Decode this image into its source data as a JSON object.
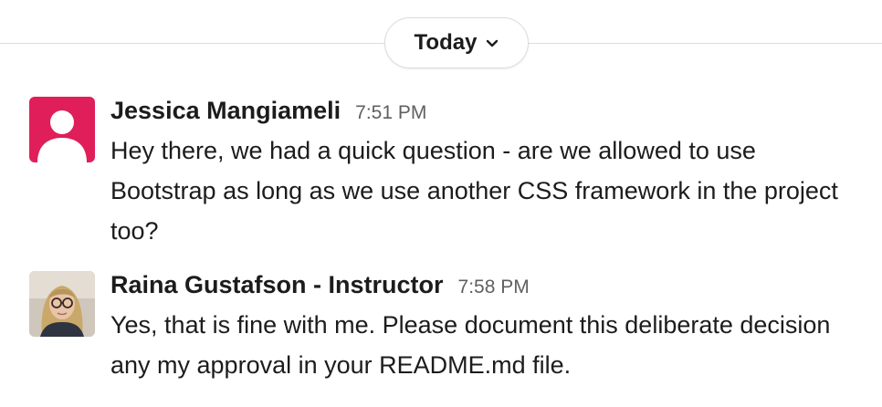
{
  "day_divider": {
    "label": "Today",
    "chevron_icon": "chevron-down-icon"
  },
  "messages": [
    {
      "author": "Jessica Mangiameli",
      "time": "7:51 PM",
      "text": "Hey there, we had a quick question - are we allowed to use Bootstrap as long as we use another CSS framework in the project too?",
      "avatar": "default-user-avatar",
      "avatar_color": "#e01e5a"
    },
    {
      "author": "Raina Gustafson - Instructor",
      "time": "7:58 PM",
      "text": "Yes, that is fine with me. Please document this deliberate decision any my approval in your README.md file.",
      "avatar": "photo-avatar"
    }
  ],
  "colors": {
    "text": "#1d1c1d",
    "timestamp": "#616061",
    "divider": "#dddddd"
  }
}
